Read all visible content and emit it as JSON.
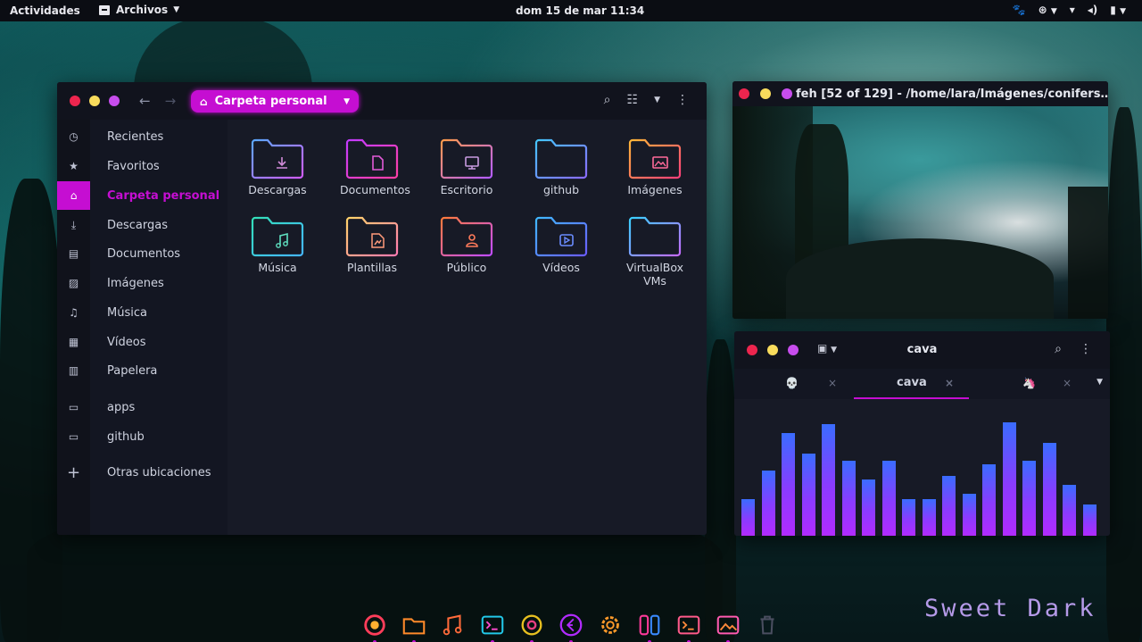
{
  "topbar": {
    "activities": "Actividades",
    "app_menu": "Archivos",
    "clock": "dom 15 de mar  11:34"
  },
  "files_window": {
    "breadcrumb": "Carpeta personal",
    "sidebar": [
      {
        "label": "Recientes",
        "icon": "clock-icon"
      },
      {
        "label": "Favoritos",
        "icon": "star-icon"
      },
      {
        "label": "Carpeta personal",
        "icon": "home-icon",
        "active": true
      },
      {
        "label": "Descargas",
        "icon": "download-icon"
      },
      {
        "label": "Documentos",
        "icon": "document-icon"
      },
      {
        "label": "Imágenes",
        "icon": "image-icon"
      },
      {
        "label": "Música",
        "icon": "music-icon"
      },
      {
        "label": "Vídeos",
        "icon": "film-icon"
      },
      {
        "label": "Papelera",
        "icon": "trash-icon"
      },
      {
        "label": "apps",
        "icon": "folder-icon"
      },
      {
        "label": "github",
        "icon": "folder-icon"
      },
      {
        "label": "Otras ubicaciones",
        "icon": "plus-icon"
      }
    ],
    "folders": [
      {
        "label": "Descargas",
        "icon": "download-folder-icon"
      },
      {
        "label": "Documentos",
        "icon": "documents-folder-icon"
      },
      {
        "label": "Escritorio",
        "icon": "desktop-folder-icon"
      },
      {
        "label": "github",
        "icon": "folder-icon"
      },
      {
        "label": "Imágenes",
        "icon": "pictures-folder-icon"
      },
      {
        "label": "Música",
        "icon": "music-folder-icon"
      },
      {
        "label": "Plantillas",
        "icon": "templates-folder-icon"
      },
      {
        "label": "Público",
        "icon": "public-folder-icon"
      },
      {
        "label": "Vídeos",
        "icon": "videos-folder-icon"
      },
      {
        "label": "VirtualBox VMs",
        "icon": "folder-icon"
      }
    ]
  },
  "feh_window": {
    "title": "feh [52 of 129] - /home/lara/Imágenes/conifers…"
  },
  "cava_window": {
    "title": "cava",
    "tabs": [
      {
        "label": "💀",
        "active": false
      },
      {
        "label": "cava",
        "active": true
      },
      {
        "label": "🦄",
        "active": false
      }
    ],
    "bar_levels": [
      0.27,
      0.48,
      0.75,
      0.6,
      0.82,
      0.55,
      0.41,
      0.55,
      0.27,
      0.27,
      0.44,
      0.31,
      0.52,
      0.83,
      0.55,
      0.68,
      0.37,
      0.23
    ]
  },
  "dock": [
    "firefox-icon",
    "files-icon",
    "music-icon",
    "terminal-icon",
    "chrome-icon",
    "vscode-icon",
    "settings-icon",
    "switch-icon",
    "terminal-alt-icon",
    "image-viewer-icon",
    "trash-icon"
  ],
  "branding": "Sweet Dark",
  "colors": {
    "accent": "#c50ed2",
    "window_bg": "#171a26",
    "close": "#ed254e",
    "minimize": "#f9dc5c",
    "maximize": "#c74ded"
  }
}
